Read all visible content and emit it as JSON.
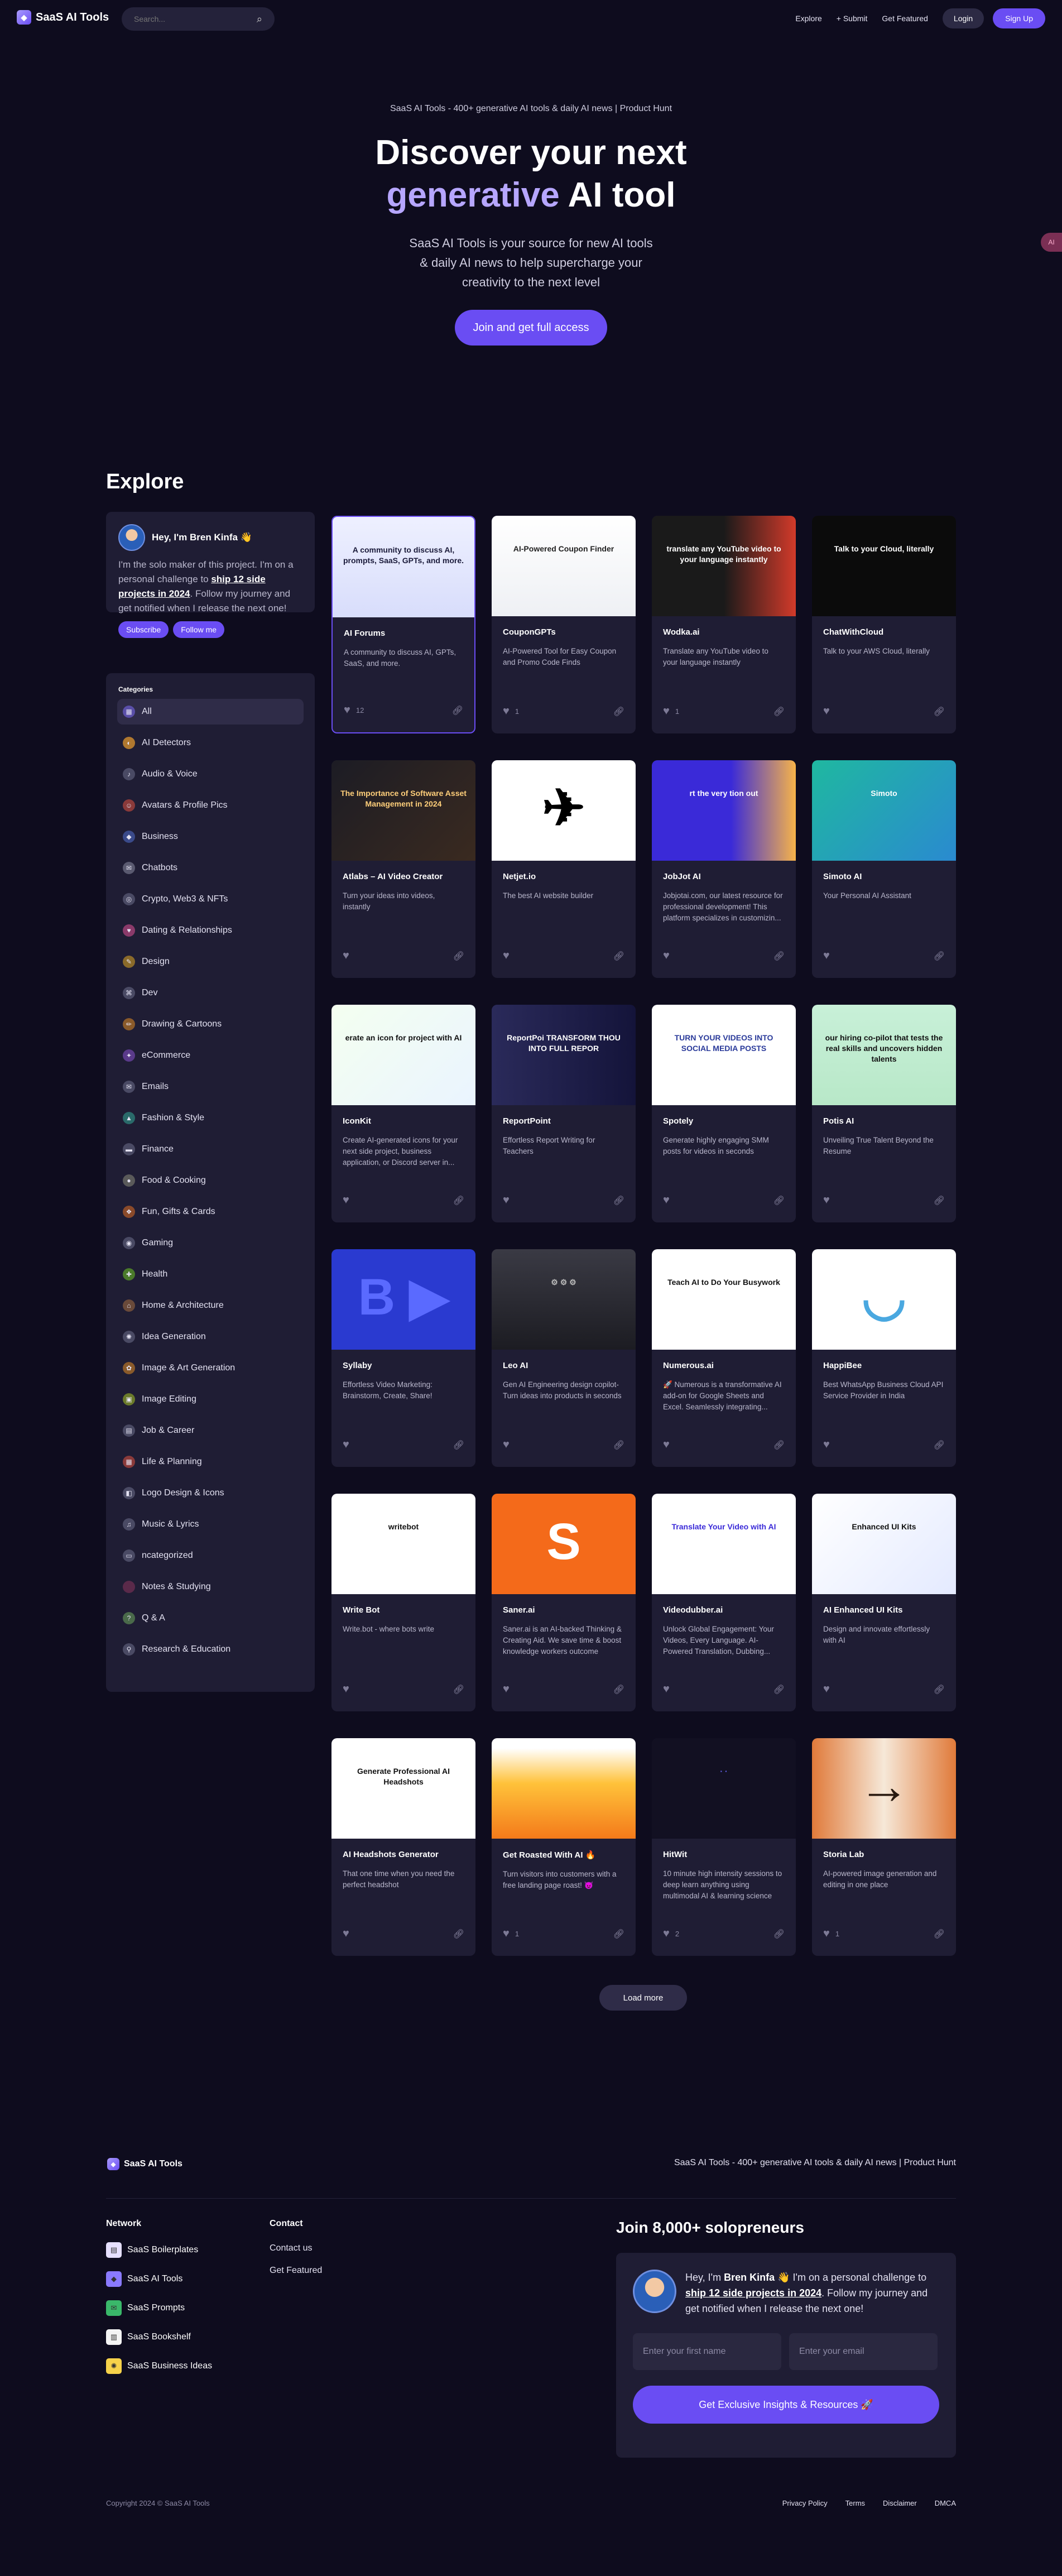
{
  "nav": {
    "brand": "SaaS AI Tools",
    "search_placeholder": "Search...",
    "links": [
      "Explore",
      "+ Submit",
      "Get Featured"
    ],
    "login": "Login",
    "signup": "Sign Up"
  },
  "hero": {
    "subtitle": "SaaS AI Tools - 400+ generative AI tools & daily AI news | Product Hunt",
    "title_line1": "Discover your next",
    "title_highlight": "generative",
    "title_rest": " AI tool",
    "description": "SaaS AI Tools is your source for new AI tools & daily AI news to help supercharge your creativity to the next level",
    "cta": "Join and get full access",
    "side_badge": "AI"
  },
  "explore": {
    "heading": "Explore",
    "profile": {
      "name": "Hey, I'm Bren Kinfa 👋",
      "text_before": "I'm the solo maker of this project. I'm on a personal challenge to ",
      "text_link": "ship 12 side projects in 2024",
      "text_after": ". Follow my journey and get notified when I release the next one!",
      "subscribe": "Subscribe",
      "follow": "Follow me"
    },
    "categories_title": "Categories",
    "categories": [
      {
        "label": "All",
        "icon": "grid-icon",
        "glyph": "▦",
        "color": "#5a4fa8"
      },
      {
        "label": "AI Detectors",
        "icon": "detector-icon",
        "glyph": "◐",
        "color": "#b0782f"
      },
      {
        "label": "Audio & Voice",
        "icon": "audio-icon",
        "glyph": "♪",
        "color": "#4a4a64"
      },
      {
        "label": "Avatars & Profile Pics",
        "icon": "avatar-icon",
        "glyph": "☺",
        "color": "#8a3a3a"
      },
      {
        "label": "Business",
        "icon": "business-icon",
        "glyph": "◆",
        "color": "#3a4a8a"
      },
      {
        "label": "Chatbots",
        "icon": "chat-icon",
        "glyph": "✉",
        "color": "#5a5a70"
      },
      {
        "label": "Crypto, Web3 & NFTs",
        "icon": "crypto-icon",
        "glyph": "◎",
        "color": "#4a4a64"
      },
      {
        "label": "Dating & Relationships",
        "icon": "heart-icon",
        "glyph": "♥",
        "color": "#8a3a6a"
      },
      {
        "label": "Design",
        "icon": "design-icon",
        "glyph": "✎",
        "color": "#8a6a2a"
      },
      {
        "label": "Dev",
        "icon": "dev-icon",
        "glyph": "⌘",
        "color": "#4a4a64"
      },
      {
        "label": "Drawing & Cartoons",
        "icon": "drawing-icon",
        "glyph": "✏",
        "color": "#8a5a2a"
      },
      {
        "label": "eCommerce",
        "icon": "cart-icon",
        "glyph": "✦",
        "color": "#5a3a8a"
      },
      {
        "label": "Emails",
        "icon": "email-icon",
        "glyph": "✉",
        "color": "#4a4a64"
      },
      {
        "label": "Fashion & Style",
        "icon": "fashion-icon",
        "glyph": "▲",
        "color": "#2a6a6a"
      },
      {
        "label": "Finance",
        "icon": "finance-icon",
        "glyph": "▬",
        "color": "#4a4a64"
      },
      {
        "label": "Food & Cooking",
        "icon": "food-icon",
        "glyph": "●",
        "color": "#5a5a5a"
      },
      {
        "label": "Fun, Gifts & Cards",
        "icon": "gift-icon",
        "glyph": "❖",
        "color": "#8a4a2a"
      },
      {
        "label": "Gaming",
        "icon": "gaming-icon",
        "glyph": "◉",
        "color": "#4a4a64"
      },
      {
        "label": "Health",
        "icon": "health-icon",
        "glyph": "✚",
        "color": "#4a7a2a"
      },
      {
        "label": "Home & Architecture",
        "icon": "home-icon",
        "glyph": "⌂",
        "color": "#6a4a3a"
      },
      {
        "label": "Idea Generation",
        "icon": "idea-icon",
        "glyph": "✺",
        "color": "#4a4a64"
      },
      {
        "label": "Image & Art Generation",
        "icon": "image-icon",
        "glyph": "✿",
        "color": "#8a5a2a"
      },
      {
        "label": "Image Editing",
        "icon": "edit-icon",
        "glyph": "▣",
        "color": "#6a7a2a"
      },
      {
        "label": "Job & Career",
        "icon": "job-icon",
        "glyph": "▤",
        "color": "#4a4a64"
      },
      {
        "label": "Life & Planning",
        "icon": "calendar-icon",
        "glyph": "▦",
        "color": "#8a3a3a"
      },
      {
        "label": "Logo Design & Icons",
        "icon": "logo-icon",
        "glyph": "◧",
        "color": "#4a4a64"
      },
      {
        "label": "Music & Lyrics",
        "icon": "music-icon",
        "glyph": "♫",
        "color": "#4a4a64"
      },
      {
        "label": "ncategorized",
        "icon": "folder-icon",
        "glyph": "▭",
        "color": "#4a4a64"
      },
      {
        "label": "Notes & Studying",
        "icon": "notes-icon",
        "glyph": "",
        "color": "#5a2a4a"
      },
      {
        "label": "Q & A",
        "icon": "qa-icon",
        "glyph": "?",
        "color": "#4a6a4a"
      },
      {
        "label": "Research & Education",
        "icon": "research-icon",
        "glyph": "⚲",
        "color": "#4a4a64"
      }
    ],
    "cards": [
      {
        "title": "AI Forums",
        "desc": "A community to discuss AI, GPTs, SaaS, and more.",
        "likes": "12",
        "bg": "linear-gradient(180deg,#eef0ff,#d8ddfb)",
        "img_text": "A community to discuss AI, prompts, SaaS, GPTs, and more.",
        "img_color": "#1a1a3a"
      },
      {
        "title": "CouponGPTs",
        "desc": "AI-Powered Tool for Easy Coupon and Promo Code Finds",
        "likes": "1",
        "bg": "linear-gradient(180deg,#ffffff,#eef0f4)",
        "img_text": "AI-Powered Coupon Finder",
        "img_color": "#222"
      },
      {
        "title": "Wodka.ai",
        "desc": "Translate any YouTube video to your language instantly",
        "likes": "1",
        "bg": "linear-gradient(90deg,#1a1a1a 50%,#d23a2a)",
        "img_text": "translate any YouTube video to your language instantly",
        "img_color": "#fff"
      },
      {
        "title": "ChatWithCloud",
        "desc": "Talk to your AWS Cloud, literally",
        "likes": "",
        "bg": "#0b0b0b",
        "img_text": "Talk to your Cloud, literally",
        "img_color": "#fff"
      },
      {
        "title": "Atlabs – AI Video Creator",
        "desc": "Turn your ideas into videos, instantly",
        "likes": "",
        "bg": "linear-gradient(135deg,#1c1c24,#3a2a20)",
        "img_text": "The Importance of Software Asset Management in 2024",
        "img_color": "#ffcf7a"
      },
      {
        "title": "Netjet.io",
        "desc": "The best AI website builder",
        "likes": "",
        "bg": "#ffffff",
        "img_text": "✈",
        "img_color": "#000"
      },
      {
        "title": "JobJot AI",
        "desc": "Jobjotai.com, our latest resource for professional development! This platform specializes in customizin...",
        "likes": "",
        "bg": "linear-gradient(90deg,#3a2ad8 55%,#f6b34a)",
        "img_text": "rt the very tion out",
        "img_color": "#fff"
      },
      {
        "title": "Simoto AI",
        "desc": "Your Personal AI Assistant",
        "likes": "",
        "bg": "linear-gradient(135deg,#1fb8a0,#2a8ad0)",
        "img_text": "Simoto",
        "img_color": "#fff"
      },
      {
        "title": "IconKit",
        "desc": "Create AI-generated icons for your next side project, business application, or Discord server in...",
        "likes": "",
        "bg": "linear-gradient(135deg,#f4fff0,#eaf4ff)",
        "img_text": "erate an icon for project with AI",
        "img_color": "#111"
      },
      {
        "title": "ReportPoint",
        "desc": "Effortless Report Writing for Teachers",
        "likes": "",
        "bg": "linear-gradient(90deg,#2a2a5a,#14143a)",
        "img_text": "ReportPoi TRANSFORM THOU INTO FULL REPOR",
        "img_color": "#fff"
      },
      {
        "title": "Spotely",
        "desc": "Generate highly engaging SMM posts for videos in seconds",
        "likes": "",
        "bg": "#ffffff",
        "img_text": "TURN YOUR VIDEOS INTO SOCIAL MEDIA POSTS",
        "img_color": "#2a3a9a"
      },
      {
        "title": "Potis AI",
        "desc": "Unveiling True Talent Beyond the Resume",
        "likes": "",
        "bg": "linear-gradient(180deg,#c8f0d8,#b8e8c8)",
        "img_text": "our hiring co-pilot that tests the real skills and uncovers hidden talents",
        "img_color": "#111"
      },
      {
        "title": "Syllaby",
        "desc": "Effortless Video Marketing: Brainstorm, Create, Share!",
        "likes": "",
        "bg": "#2a3ad0",
        "img_text": "B ▶",
        "img_color": "#5a6aff"
      },
      {
        "title": "Leo AI",
        "desc": "Gen AI Engineering design copilot- Turn ideas into products in seconds",
        "likes": "",
        "bg": "linear-gradient(180deg,#3a3a44,#1c1c22)",
        "img_text": "⚙ ⚙ ⚙",
        "img_color": "#bbb"
      },
      {
        "title": "Numerous.ai",
        "desc": "🚀 Numerous is a transformative AI add-on for Google Sheets and Excel. Seamlessly integrating...",
        "likes": "",
        "bg": "#ffffff",
        "img_text": "Teach AI to Do Your Busywork",
        "img_color": "#111"
      },
      {
        "title": "HappiBee",
        "desc": "Best WhatsApp Business Cloud API Service Provider in India",
        "likes": "",
        "bg": "#ffffff",
        "img_text": "◡",
        "img_color": "#4aa8e0"
      },
      {
        "title": "Write Bot",
        "desc": "Write.bot - where bots write",
        "likes": "",
        "bg": "#ffffff",
        "img_text": "writebot",
        "img_color": "#111"
      },
      {
        "title": "Saner.ai",
        "desc": "Saner.ai is an AI-backed Thinking & Creating Aid. We save time & boost knowledge workers outcome",
        "likes": "",
        "bg": "#f46a1a",
        "img_text": "S",
        "img_color": "#fff"
      },
      {
        "title": "Videodubber.ai",
        "desc": "Unlock Global Engagement: Your Videos, Every Language. AI-Powered Translation, Dubbing...",
        "likes": "",
        "bg": "#ffffff",
        "img_text": "Translate Your Video with AI",
        "img_color": "#3a2ad8"
      },
      {
        "title": "AI Enhanced UI Kits",
        "desc": "Design and innovate effortlessly with AI",
        "likes": "",
        "bg": "linear-gradient(135deg,#ffffff,#e4eaff)",
        "img_text": "Enhanced UI Kits",
        "img_color": "#111"
      },
      {
        "title": "AI Headshots Generator",
        "desc": "That one time when you need the perfect headshot",
        "likes": "",
        "bg": "#ffffff",
        "img_text": "Generate Professional AI Headshots",
        "img_color": "#111"
      },
      {
        "title": "Get Roasted With AI 🔥",
        "desc": "Turn visitors into customers with a free landing page roast! 😈",
        "likes": "1",
        "bg": "linear-gradient(180deg,#ffffff 10%,#ffc23a 45%,#f47a1a)",
        "img_text": "",
        "img_color": "#fff"
      },
      {
        "title": "HitWit",
        "desc": "10 minute high intensity sessions to deep learn anything using multimodal AI & learning science",
        "likes": "2",
        "bg": "#121022",
        "img_text": "·  ·",
        "img_color": "#6a6aff"
      },
      {
        "title": "Storia Lab",
        "desc": "AI-powered image generation and editing in one place",
        "likes": "1",
        "bg": "linear-gradient(90deg,#e07a3a,#f6e8d8 50%,#e07a3a)",
        "img_text": "→",
        "img_color": "#2a1a10"
      }
    ],
    "load_more": "Load more"
  },
  "footer": {
    "brand": "SaaS AI Tools",
    "tagline": "SaaS AI Tools - 400+ generative AI tools & daily AI news | Product Hunt",
    "network_title": "Network",
    "network": [
      {
        "label": "SaaS Boilerplates",
        "icon": "boilerplate-icon",
        "glyph": "▤",
        "color": "#e6e0ff"
      },
      {
        "label": "SaaS AI Tools",
        "icon": "ai-tools-icon",
        "glyph": "◆",
        "color": "#8a7aff"
      },
      {
        "label": "SaaS Prompts",
        "icon": "prompts-icon",
        "glyph": "✉",
        "color": "#3ab86a"
      },
      {
        "label": "SaaS Bookshelf",
        "icon": "bookshelf-icon",
        "glyph": "▥",
        "color": "#f4f4f4"
      },
      {
        "label": "SaaS Business Ideas",
        "icon": "ideas-icon",
        "glyph": "✺",
        "color": "#f6d24a"
      }
    ],
    "contact_title": "Contact",
    "contact": [
      "Contact us",
      "Get Featured"
    ],
    "join_title": "Join 8,000+ solopreneurs",
    "join_hey": "Hey, I'm ",
    "join_name": "Bren Kinfa",
    "join_mid": " 👋 I'm on a personal challenge to ",
    "join_link": "ship 12 side projects in 2024",
    "join_end": ". Follow my journey and get notified when I release the next one!",
    "first_name_placeholder": "Enter your first name",
    "email_placeholder": "Enter your email",
    "join_button": "Get Exclusive Insights & Resources 🚀",
    "copyright": "Copyright 2024 © SaaS AI Tools",
    "legal": [
      "Privacy Policy",
      "Terms",
      "Disclaimer",
      "DMCA"
    ]
  }
}
